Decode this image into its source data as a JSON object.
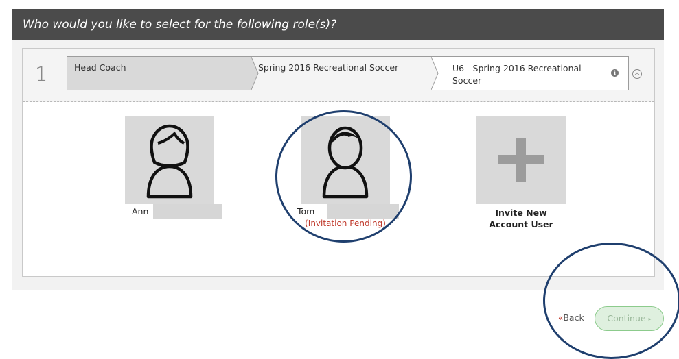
{
  "header": {
    "title": "Who would you like to select for the following role(s)?"
  },
  "role": {
    "number": "1",
    "crumbs": [
      "Head Coach",
      "Spring 2016 Recreational Soccer",
      "U6 - Spring 2016 Recreational Soccer"
    ],
    "info_icon": "info-icon",
    "collapse_icon": "chevron-up-circle-icon"
  },
  "people": [
    {
      "name": "Ann",
      "avatar": "female-user-icon"
    },
    {
      "name": "Tom",
      "status": "(Invitation Pending)",
      "avatar": "male-user-icon"
    }
  ],
  "invite": {
    "label_line1": "Invite New",
    "label_line2": "Account User",
    "icon": "plus-icon"
  },
  "footer": {
    "back_label": "Back",
    "back_icon": "«",
    "continue_label": "Continue",
    "continue_icon": "▸"
  },
  "colors": {
    "header_bg": "#4b4b4b",
    "pending_text": "#c0392b",
    "continue_bg": "#dff0df",
    "annotation_ring": "#1f3f6e"
  }
}
